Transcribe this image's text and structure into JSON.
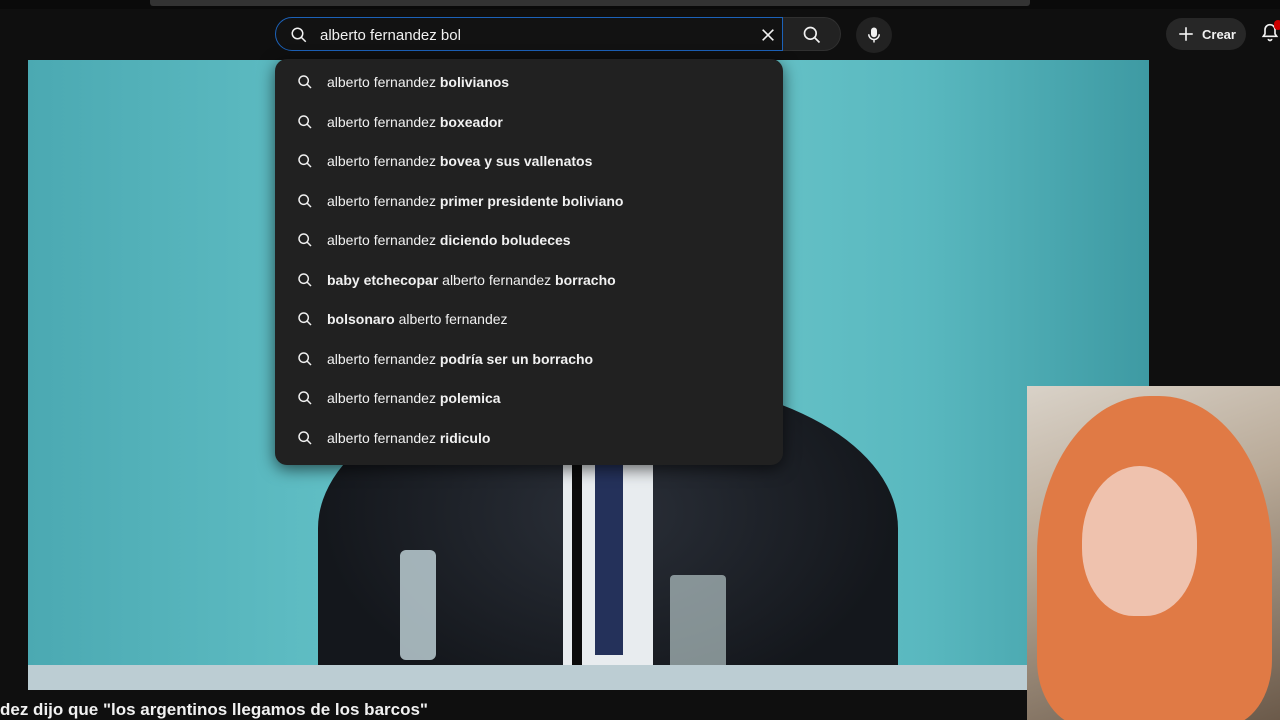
{
  "search": {
    "query": "alberto fernandez bol",
    "icon": "search-icon",
    "clear_icon": "close-icon"
  },
  "header": {
    "search_button_icon": "search-icon",
    "mic_icon": "mic-icon",
    "create_label": "Crear",
    "notification_icon": "bell-icon"
  },
  "suggestions": [
    {
      "prefix": "alberto fernandez ",
      "bold": "bolivianos",
      "suffix": ""
    },
    {
      "prefix": "alberto fernandez ",
      "bold": "boxeador",
      "suffix": ""
    },
    {
      "prefix": "alberto fernandez ",
      "bold": "bovea y sus vallenatos",
      "suffix": ""
    },
    {
      "prefix": "alberto fernandez ",
      "bold": "primer presidente boliviano",
      "suffix": ""
    },
    {
      "prefix": "alberto fernandez ",
      "bold": "diciendo boludeces",
      "suffix": ""
    },
    {
      "prefix": "",
      "bold": "baby etchecopar ",
      "suffix": "alberto fernandez",
      "tail": " borracho"
    },
    {
      "prefix": "",
      "bold": "bolsonaro ",
      "suffix": "alberto fernandez"
    },
    {
      "prefix": "alberto fernandez ",
      "bold": "podría ser un borracho",
      "suffix": ""
    },
    {
      "prefix": "alberto fernandez ",
      "bold": "polemica",
      "suffix": ""
    },
    {
      "prefix": "alberto fernandez ",
      "bold": "ridiculo",
      "suffix": ""
    }
  ],
  "video": {
    "title_partial": "dez dijo que \"los argentinos llegamos de los barcos\""
  }
}
